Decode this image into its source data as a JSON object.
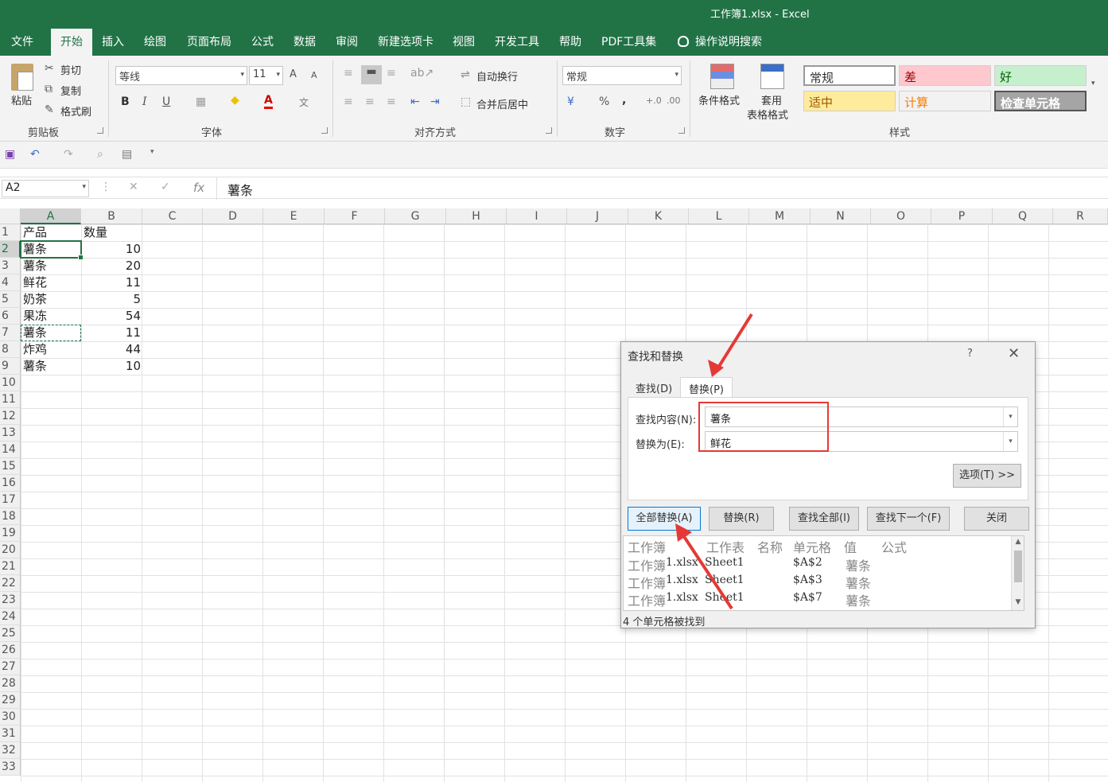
{
  "window": {
    "title": "工作簿1.xlsx  -  Excel"
  },
  "tabs": [
    {
      "label": "文件"
    },
    {
      "label": "开始"
    },
    {
      "label": "插入"
    },
    {
      "label": "绘图"
    },
    {
      "label": "页面布局"
    },
    {
      "label": "公式"
    },
    {
      "label": "数据"
    },
    {
      "label": "审阅"
    },
    {
      "label": "新建选项卡"
    },
    {
      "label": "视图"
    },
    {
      "label": "开发工具"
    },
    {
      "label": "帮助"
    },
    {
      "label": "PDF工具集"
    },
    {
      "label": "操作说明搜索"
    }
  ],
  "ribbon": {
    "clipboard": {
      "paste": "粘贴",
      "cut": "剪切",
      "copy": "复制",
      "format_painter": "格式刷",
      "group": "剪贴板"
    },
    "font": {
      "name": "等线",
      "size": "11",
      "grow": "A",
      "shrink": "A",
      "bold": "B",
      "italic": "I",
      "underline": "U",
      "color_a": "A",
      "phonetic": "文",
      "group": "字体"
    },
    "align": {
      "wrap": "自动换行",
      "merge": "合并后居中",
      "group": "对齐方式"
    },
    "number": {
      "format": "常规",
      "percent": "%",
      "comma": ",",
      "group": "数字"
    },
    "styles": {
      "conditional": "条件格式",
      "table_line1": "套用",
      "table_line2": "表格格式",
      "cells": [
        {
          "label": "常规",
          "bg": "#ffffff",
          "fg": "#333333"
        },
        {
          "label": "差",
          "bg": "#ffc7ce",
          "fg": "#9c0006"
        },
        {
          "label": "好",
          "bg": "#c6efce",
          "fg": "#006100"
        },
        {
          "label": "适中",
          "bg": "#ffeb9c",
          "fg": "#9c5700"
        },
        {
          "label": "计算",
          "bg": "#f2f2f2",
          "fg": "#fa7d00"
        },
        {
          "label": "检查单元格",
          "bg": "#a5a5a5",
          "fg": "#ffffff"
        }
      ],
      "group": "样式"
    }
  },
  "formula_bar": {
    "name_box": "A2",
    "fx": "fx",
    "content": "薯条"
  },
  "columns": [
    "A",
    "B",
    "C",
    "D",
    "E",
    "F",
    "G",
    "H",
    "I",
    "J",
    "K",
    "L",
    "M",
    "N",
    "O",
    "P",
    "Q",
    "R"
  ],
  "rows": [
    "1",
    "2",
    "3",
    "4",
    "5",
    "6",
    "7",
    "8",
    "9",
    "10",
    "11",
    "12",
    "13",
    "14",
    "15",
    "16",
    "17",
    "18",
    "19",
    "20",
    "21",
    "22",
    "23",
    "24",
    "25",
    "26",
    "27",
    "28",
    "29",
    "30",
    "31",
    "32",
    "33"
  ],
  "sheet": {
    "header": {
      "a": "产品",
      "b": "数量"
    },
    "data": [
      {
        "a": "薯条",
        "b": "10"
      },
      {
        "a": "薯条",
        "b": "20"
      },
      {
        "a": "鲜花",
        "b": "11"
      },
      {
        "a": "奶茶",
        "b": "5"
      },
      {
        "a": "果冻",
        "b": "54"
      },
      {
        "a": "薯条",
        "b": "11"
      },
      {
        "a": "炸鸡",
        "b": "44"
      },
      {
        "a": "薯条",
        "b": "10"
      }
    ]
  },
  "dialog": {
    "title": "查找和替换",
    "help": "?",
    "close": "✕",
    "tabs": {
      "find": "查找(D)",
      "replace": "替换(P)"
    },
    "find_label": "查找内容(N):",
    "find_value": "薯条",
    "replace_label": "替换为(E):",
    "replace_value": "鲜花",
    "options_button": "选项(T) >>",
    "buttons": {
      "replace_all": "全部替换(A)",
      "replace": "替换(R)",
      "find_all": "查找全部(I)",
      "find_next": "查找下一个(F)",
      "close": "关闭"
    },
    "results_header": {
      "workbook": "工作簿",
      "sheet": "工作表",
      "name": "名称",
      "cell": "单元格",
      "value": "值",
      "formula": "公式"
    },
    "results": [
      {
        "workbook_prefix": "工作簿",
        "workbook_suffix": "1.xlsx",
        "sheet": "Sheet1",
        "cell": "$A$2",
        "value": "薯条"
      },
      {
        "workbook_prefix": "工作簿",
        "workbook_suffix": "1.xlsx",
        "sheet": "Sheet1",
        "cell": "$A$3",
        "value": "薯条"
      },
      {
        "workbook_prefix": "工作簿",
        "workbook_suffix": "1.xlsx",
        "sheet": "Sheet1",
        "cell": "$A$7",
        "value": "薯条"
      }
    ],
    "status": "4 个单元格被找到"
  },
  "annotation_color": "#e53935",
  "accent_color": "#217346"
}
